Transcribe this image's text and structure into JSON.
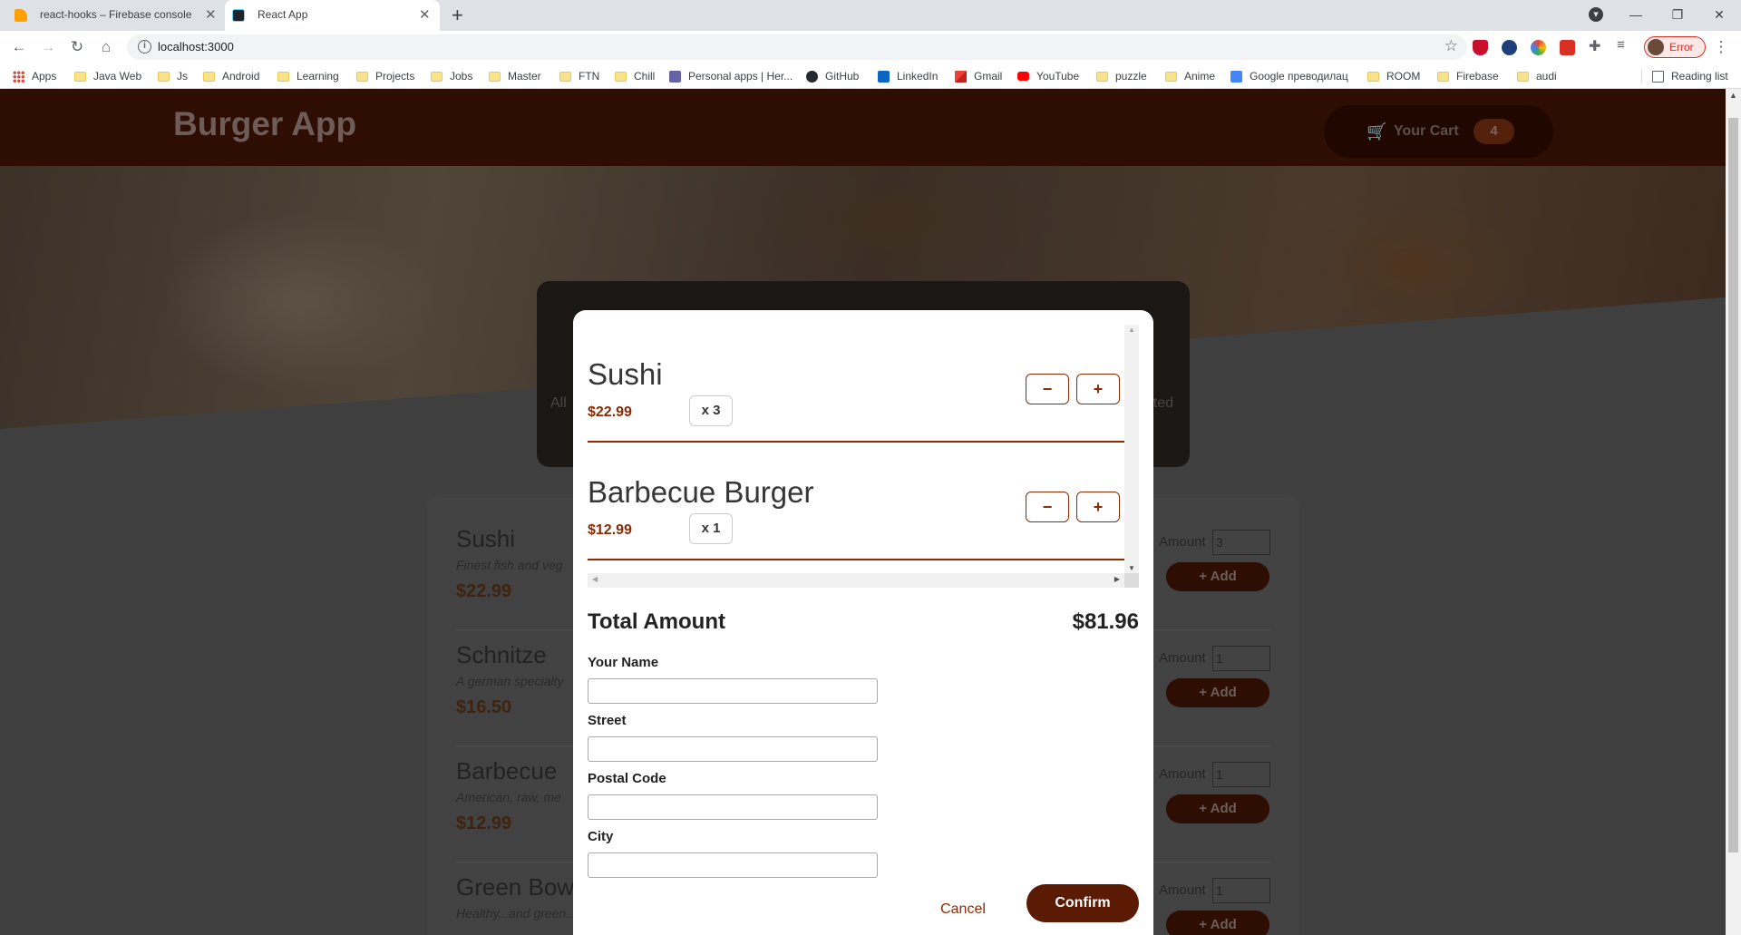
{
  "browser": {
    "tabs": [
      {
        "title": "react-hooks – Firebase console",
        "active": false
      },
      {
        "title": "React App",
        "active": true
      }
    ],
    "new_tab": "+",
    "url": "localhost:3000",
    "profile_label": "Error",
    "bookmarks": [
      "Apps",
      "Java Web",
      "Js",
      "Android",
      "Learning",
      "Projects",
      "Jobs",
      "Master",
      "FTN",
      "Chill",
      "Personal apps | Her...",
      "GitHub",
      "LinkedIn",
      "Gmail",
      "YouTube",
      "puzzle",
      "Anime",
      "Google преводилац",
      "ROOM",
      "Firebase",
      "audi"
    ],
    "reading_list": "Reading list"
  },
  "app": {
    "title": "Burger App",
    "cart_label": "Your Cart",
    "cart_count": "4",
    "summary_left": "All",
    "summary_right": "ted",
    "meals": [
      {
        "name": "Sushi",
        "description": "Finest fish and veg",
        "price": "$22.99",
        "amount_label": "Amount",
        "amount": "3",
        "add_label": "+ Add"
      },
      {
        "name": "Schnitze",
        "description": "A german specialty",
        "price": "$16.50",
        "amount_label": "Amount",
        "amount": "1",
        "add_label": "+ Add"
      },
      {
        "name": "Barbecue",
        "description": "American, raw, me",
        "price": "$12.99",
        "amount_label": "Amount",
        "amount": "1",
        "add_label": "+ Add"
      },
      {
        "name": "Green Bowl",
        "description": "Healthy...and green...",
        "price": "",
        "amount_label": "Amount",
        "amount": "1",
        "add_label": "+ Add"
      }
    ]
  },
  "modal": {
    "cart_items": [
      {
        "name": "Sushi",
        "price": "$22.99",
        "qty": "x 3"
      },
      {
        "name": "Barbecue Burger",
        "price": "$12.99",
        "qty": "x 1"
      }
    ],
    "minus": "−",
    "plus": "+",
    "total_label": "Total Amount",
    "total_value": "$81.96",
    "fields": [
      "Your Name",
      "Street",
      "Postal Code",
      "City"
    ],
    "cancel_label": "Cancel",
    "confirm_label": "Confirm"
  },
  "colors": {
    "primary": "#8a2b06",
    "header": "#3f1000",
    "confirm": "#5a1a04"
  }
}
